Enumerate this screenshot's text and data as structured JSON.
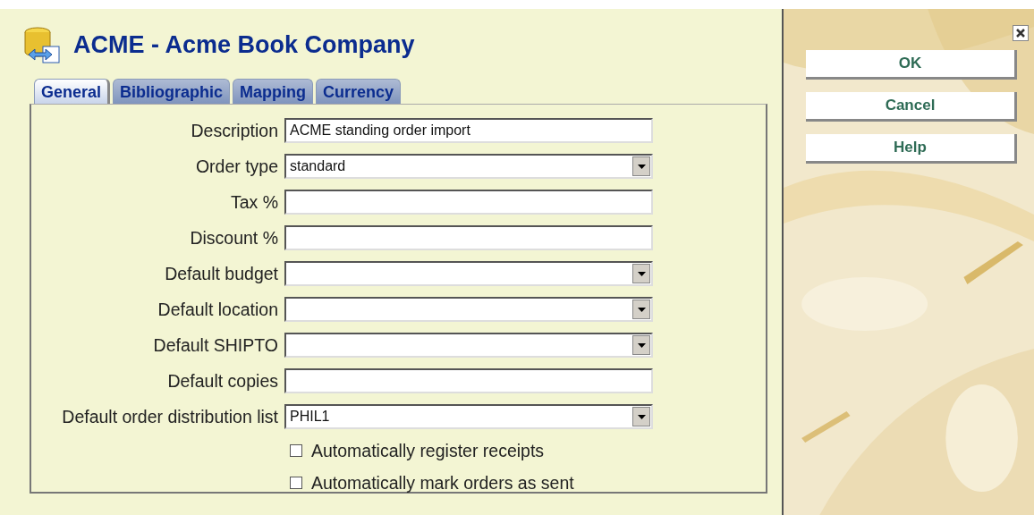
{
  "header": {
    "title": "ACME - Acme Book Company"
  },
  "tabs": [
    {
      "label": "General",
      "selected": true
    },
    {
      "label": "Bibliographic",
      "selected": false
    },
    {
      "label": "Mapping",
      "selected": false
    },
    {
      "label": "Currency",
      "selected": false
    }
  ],
  "fields": [
    {
      "kind": "text",
      "label": "Description",
      "value": "ACME standing order import"
    },
    {
      "kind": "select",
      "label": "Order type",
      "value": "standard"
    },
    {
      "kind": "text",
      "label": "Tax %"
    },
    {
      "kind": "text",
      "label": "Discount %"
    },
    {
      "kind": "select",
      "label": "Default budget"
    },
    {
      "kind": "select",
      "label": "Default location"
    },
    {
      "kind": "select",
      "label": "Default SHIPTO"
    },
    {
      "kind": "text",
      "label": "Default copies"
    },
    {
      "kind": "select",
      "label": "Default order distribution list",
      "value": "PHIL1"
    }
  ],
  "checkboxes": [
    {
      "label": "Automatically register receipts",
      "checked": false
    },
    {
      "label": "Automatically mark orders as sent",
      "checked": false
    }
  ],
  "buttons": [
    "OK",
    "Cancel",
    "Help"
  ]
}
